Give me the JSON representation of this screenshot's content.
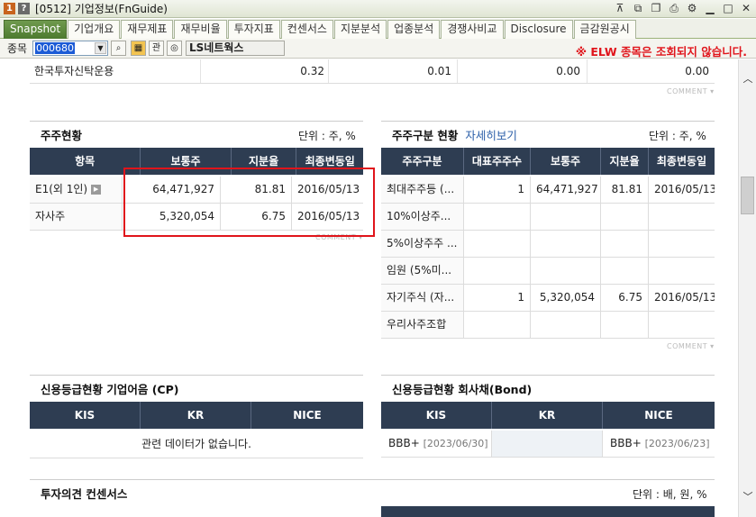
{
  "window": {
    "badge_num": "1",
    "badge_help": "?",
    "title": "[0512] 기업정보(FnGuide)",
    "icons": [
      "pin-icon",
      "link-icon",
      "copy-icon",
      "print-icon",
      "gear-icon",
      "minimize-icon",
      "maximize-icon",
      "close-icon"
    ]
  },
  "tabs": [
    "Snapshot",
    "기업개요",
    "재무제표",
    "재무비율",
    "투자지표",
    "컨센서스",
    "지분분석",
    "업종분석",
    "경쟁사비교",
    "Disclosure",
    "금감원공시"
  ],
  "search": {
    "label": "종목",
    "code": "000680",
    "btn_search": "⌕",
    "btn_chart": "▦",
    "btn_kwan": "관",
    "btn_cash": "◎",
    "name": "LS네트웍스",
    "warning": "※ ELW 종목은 조회되지 않습니다."
  },
  "top_row": {
    "name": "한국투자신탁운용",
    "values": [
      "0.32",
      "0.01",
      "0.00",
      "0.00"
    ],
    "comment": "COMMENT"
  },
  "shareholders": {
    "title": "주주현황",
    "unit": "단위 : 주, %",
    "headers": [
      "항목",
      "보통주",
      "지분율",
      "최종변동일"
    ],
    "rows": [
      {
        "name": "E1(외 1인)",
        "shares": "64,471,927",
        "ratio": "81.81",
        "date": "2016/05/13"
      },
      {
        "name": "자사주",
        "shares": "5,320,054",
        "ratio": "6.75",
        "date": "2016/05/13"
      }
    ],
    "comment": "COMMENT"
  },
  "holder_types": {
    "title": "주주구분 현황",
    "more": "자세히보기",
    "unit": "단위 : 주, %",
    "headers": [
      "주주구분",
      "대표주주수",
      "보통주",
      "지분율",
      "최종변동일"
    ],
    "rows": [
      {
        "type": "최대주주등 (...",
        "count": "1",
        "shares": "64,471,927",
        "ratio": "81.81",
        "date": "2016/05/13"
      },
      {
        "type": "10%이상주...",
        "count": "",
        "shares": "",
        "ratio": "",
        "date": ""
      },
      {
        "type": "5%이상주주 ...",
        "count": "",
        "shares": "",
        "ratio": "",
        "date": ""
      },
      {
        "type": "임원 (5%미...",
        "count": "",
        "shares": "",
        "ratio": "",
        "date": ""
      },
      {
        "type": "자기주식 (자...",
        "count": "1",
        "shares": "5,320,054",
        "ratio": "6.75",
        "date": "2016/05/13"
      },
      {
        "type": "우리사주조합",
        "count": "",
        "shares": "",
        "ratio": "",
        "date": ""
      }
    ],
    "comment": "COMMENT"
  },
  "credit_cp": {
    "title": "신용등급현황 기업어음 (CP)",
    "headers": [
      "KIS",
      "KR",
      "NICE"
    ],
    "nodata": "관련 데이터가 없습니다."
  },
  "credit_bond": {
    "title": "신용등급현황 회사채(Bond)",
    "headers": [
      "KIS",
      "KR",
      "NICE"
    ],
    "kis_grade": "BBB+",
    "kis_date": "[2023/06/30]",
    "kr_grade": "",
    "nice_grade": "BBB+",
    "nice_date": "[2023/06/23]"
  },
  "consensus": {
    "title": "투자의견 컨센서스",
    "unit": "단위 : 배, 원, %"
  }
}
